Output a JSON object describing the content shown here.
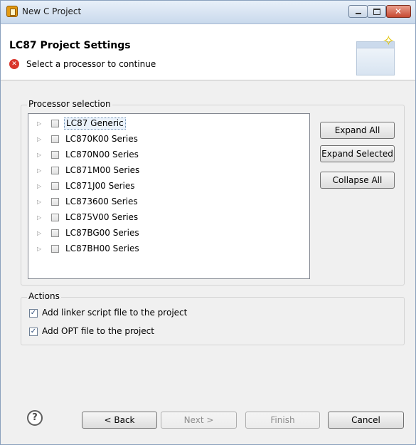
{
  "window": {
    "title": "New C Project"
  },
  "header": {
    "title": "LC87 Project Settings",
    "message": "Select a processor to continue"
  },
  "processor_group": {
    "label": "Processor selection",
    "items": [
      {
        "label": "LC87 Generic",
        "checked": false,
        "selected": true
      },
      {
        "label": "LC870K00 Series",
        "checked": false
      },
      {
        "label": "LC870N00 Series",
        "checked": false
      },
      {
        "label": "LC871M00 Series",
        "checked": false
      },
      {
        "label": "LC871J00 Series",
        "checked": false
      },
      {
        "label": "LC873600 Series",
        "checked": false
      },
      {
        "label": "LC875V00 Series",
        "checked": false
      },
      {
        "label": "LC87BG00 Series",
        "checked": false
      },
      {
        "label": "LC87BH00 Series",
        "checked": false
      }
    ],
    "buttons": {
      "expand_all": "Expand All",
      "expand_selected": "Expand Selected",
      "collapse_all": "Collapse All"
    }
  },
  "actions_group": {
    "label": "Actions",
    "items": [
      {
        "label": "Add linker script file to the project",
        "checked": true
      },
      {
        "label": "Add OPT file to the project",
        "checked": true
      }
    ]
  },
  "footer": {
    "help_symbol": "?",
    "back": "< Back",
    "next": "Next >",
    "finish": "Finish",
    "cancel": "Cancel"
  },
  "icons": {
    "error_symbol": "✕",
    "check_symbol": "✓",
    "expander_symbol": "▷"
  }
}
